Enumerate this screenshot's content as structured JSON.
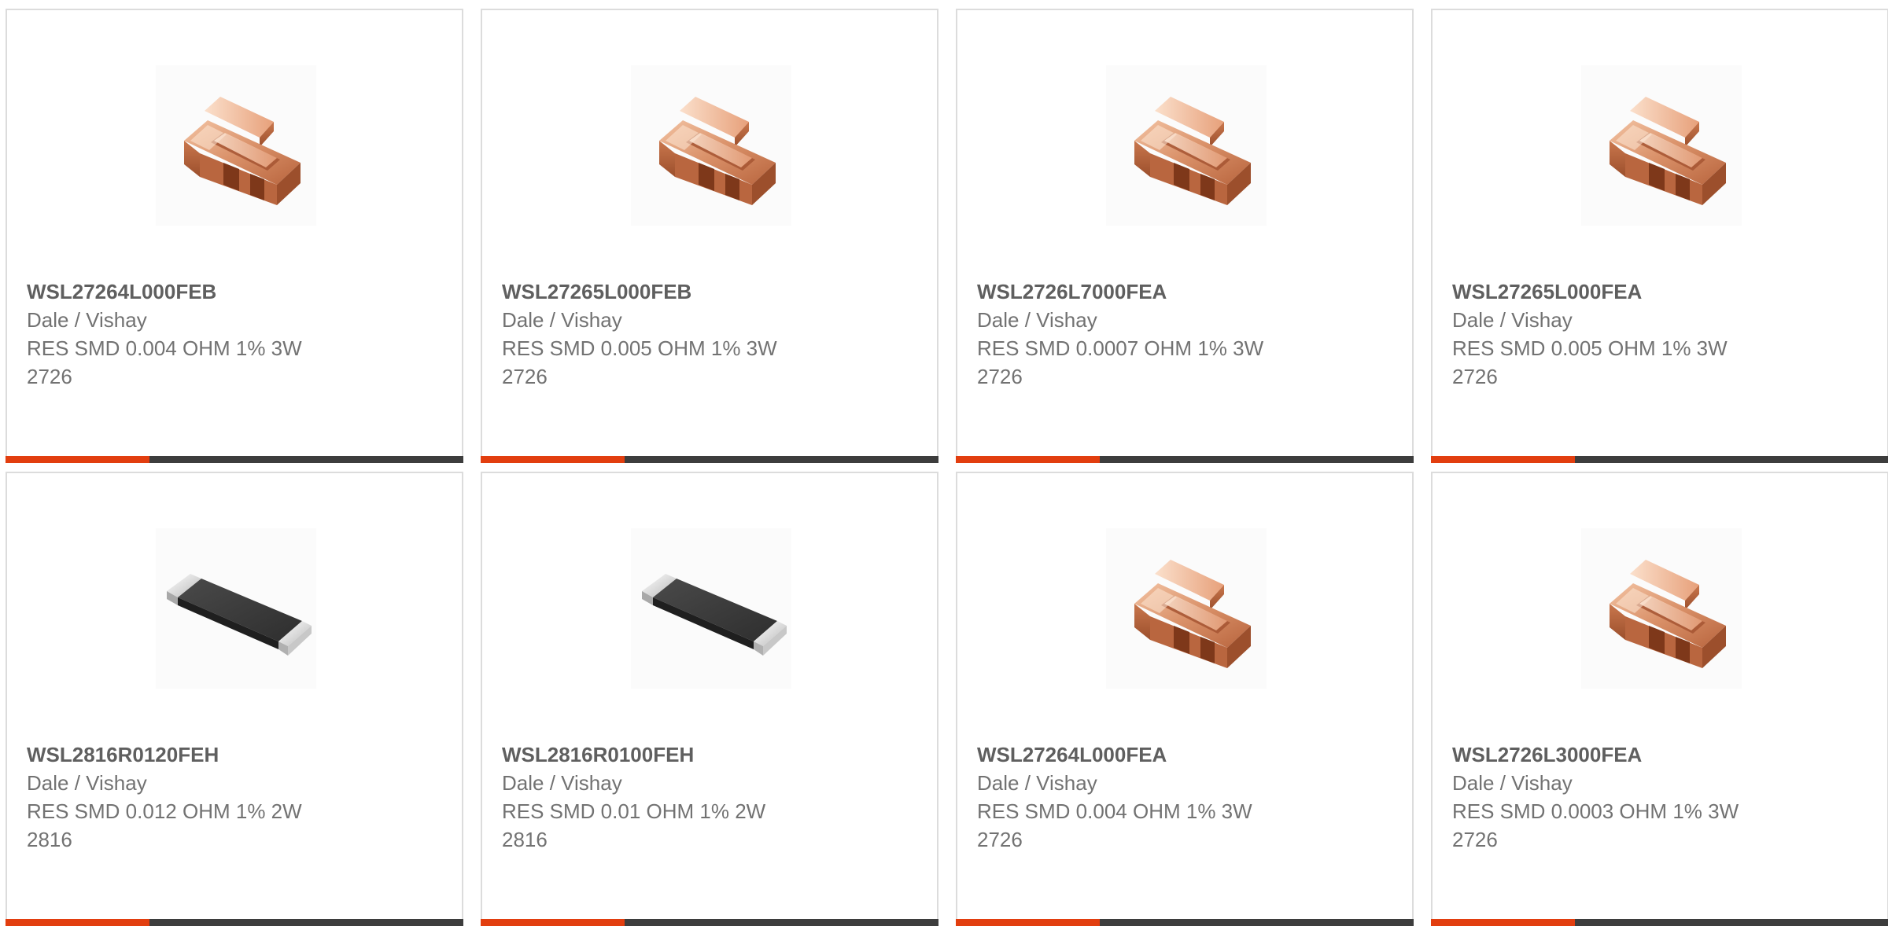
{
  "accent_color": "#e23e0f",
  "bar_color": "#3d3d3d",
  "products": [
    {
      "part_number": "WSL27264L000FEB",
      "manufacturer": "Dale / Vishay",
      "description": "RES SMD 0.004 OHM 1% 3W",
      "package": "2726",
      "image_icon": "copper-strip-resistor-icon"
    },
    {
      "part_number": "WSL27265L000FEB",
      "manufacturer": "Dale / Vishay",
      "description": "RES SMD 0.005 OHM 1% 3W",
      "package": "2726",
      "image_icon": "copper-strip-resistor-icon"
    },
    {
      "part_number": "WSL2726L7000FEA",
      "manufacturer": "Dale / Vishay",
      "description": "RES SMD 0.0007 OHM 1% 3W",
      "package": "2726",
      "image_icon": "copper-strip-resistor-icon"
    },
    {
      "part_number": "WSL27265L000FEA",
      "manufacturer": "Dale / Vishay",
      "description": "RES SMD 0.005 OHM 1% 3W",
      "package": "2726",
      "image_icon": "copper-strip-resistor-icon"
    },
    {
      "part_number": "WSL2816R0120FEH",
      "manufacturer": "Dale / Vishay",
      "description": "RES SMD 0.012 OHM 1% 2W",
      "package": "2816",
      "image_icon": "chip-resistor-icon"
    },
    {
      "part_number": "WSL2816R0100FEH",
      "manufacturer": "Dale / Vishay",
      "description": "RES SMD 0.01 OHM 1% 2W",
      "package": "2816",
      "image_icon": "chip-resistor-icon"
    },
    {
      "part_number": "WSL27264L000FEA",
      "manufacturer": "Dale / Vishay",
      "description": "RES SMD 0.004 OHM 1% 3W",
      "package": "2726",
      "image_icon": "copper-strip-resistor-icon"
    },
    {
      "part_number": "WSL2726L3000FEA",
      "manufacturer": "Dale / Vishay",
      "description": "RES SMD 0.0003 OHM 1% 3W",
      "package": "2726",
      "image_icon": "copper-strip-resistor-icon"
    }
  ]
}
